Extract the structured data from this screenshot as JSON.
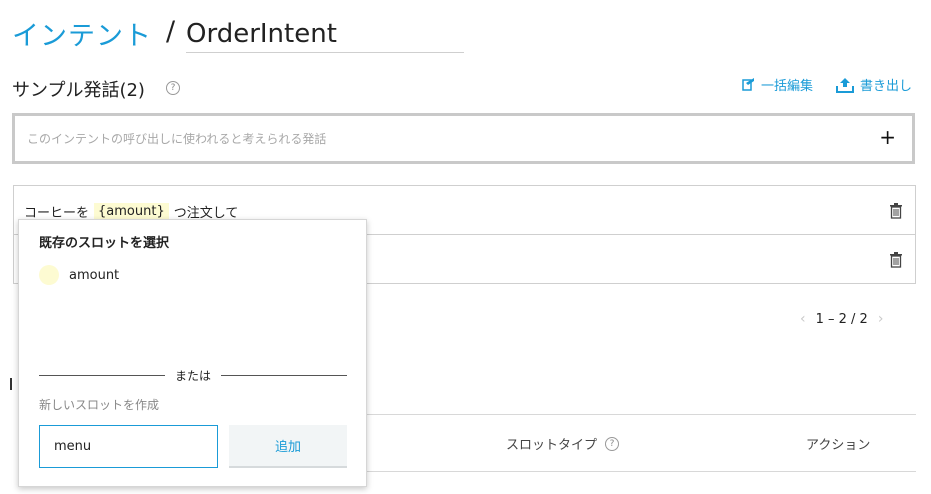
{
  "header": {
    "breadcrumb_root": "インテント",
    "separator": "/",
    "intent_name": "OrderIntent"
  },
  "utterances": {
    "title": "サンプル発話(2)",
    "help": "?",
    "bulk_edit_label": "一括編集",
    "export_label": "書き出し",
    "input_placeholder": "このインテントの呼び出しに使われると考えられる発話",
    "add_symbol": "+",
    "rows": [
      {
        "before": "コーヒーを",
        "slot": "{amount}",
        "after": "つ注文して"
      }
    ]
  },
  "pagination": {
    "range": "1 – 2 / 2",
    "prev": "‹",
    "next": "›"
  },
  "slot_table": {
    "col_slot_type": "スロットタイプ",
    "col_action": "アクション",
    "help": "?"
  },
  "slot_popup": {
    "title": "既存のスロットを選択",
    "existing_slots": [
      {
        "name": "amount"
      }
    ],
    "or_text": "または",
    "new_slot_label": "新しいスロットを作成",
    "new_slot_value": "menu",
    "add_button": "追加"
  },
  "colors": {
    "accent": "#1a9bd7",
    "slot_highlight": "#fdfbd2"
  }
}
